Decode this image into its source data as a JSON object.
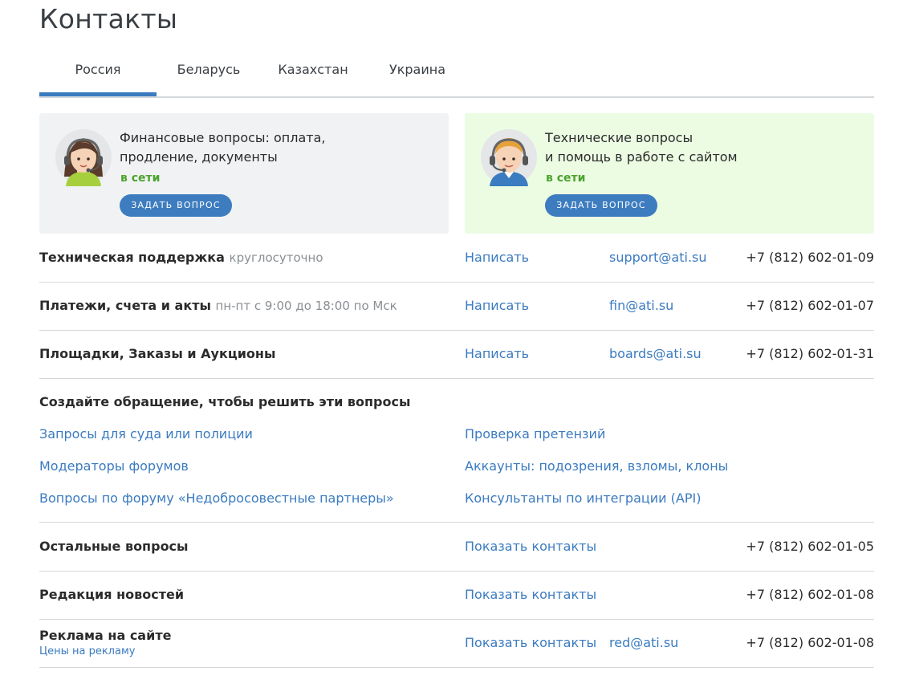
{
  "page": {
    "title": "Контакты"
  },
  "tabs": [
    {
      "label": "Россия",
      "active": true
    },
    {
      "label": "Беларусь",
      "active": false
    },
    {
      "label": "Казахстан",
      "active": false
    },
    {
      "label": "Украина",
      "active": false
    }
  ],
  "cards": {
    "finance": {
      "line1": "Финансовые вопросы: оплата,",
      "line2": "продление, документы",
      "status": "в сети",
      "button": "ЗАДАТЬ ВОПРОС",
      "avatar_icon": "female-operator-headset-icon",
      "background": "#f1f2f3"
    },
    "technical": {
      "line1": "Технические вопросы",
      "line2": "и помощь в работе с сайтом",
      "status": "в сети",
      "button": "ЗАДАТЬ ВОПРОС",
      "avatar_icon": "male-operator-headset-icon",
      "background": "#ecfce3"
    }
  },
  "rows": {
    "support": {
      "label": "Техническая поддержка",
      "note": "круглосуточно",
      "action": "Написать",
      "email": "support@ati.su",
      "phone": "+7 (812) 602-01-09"
    },
    "payments": {
      "label": "Платежи, счета и акты",
      "note": "пн-пт с 9:00 до 18:00 по Мск",
      "action": "Написать",
      "email": "fin@ati.su",
      "phone": "+7 (812) 602-01-07"
    },
    "boards": {
      "label": "Площадки, Заказы и Аукционы",
      "action": "Написать",
      "email": "boards@ati.su",
      "phone": "+7 (812) 602-01-31"
    },
    "other": {
      "label": "Остальные вопросы",
      "action": "Показать контакты",
      "phone": "+7 (812) 602-01-05"
    },
    "news": {
      "label": "Редакция новостей",
      "action": "Показать контакты",
      "phone": "+7 (812) 602-01-08"
    },
    "ads": {
      "label": "Реклама на сайте",
      "sublink": "Цены на рекламу",
      "action": "Показать контакты",
      "email": "red@ati.su",
      "phone": "+7 (812) 602-01-08"
    }
  },
  "appeals": {
    "title": "Создайте обращение, чтобы решить эти вопросы",
    "left": [
      "Запросы для суда или полиции",
      "Модераторы форумов",
      "Вопросы по форуму «Недобросовестные партнеры»"
    ],
    "right": [
      "Проверка претензий",
      "Аккаунты: подозрения, взломы, клоны",
      "Консультанты по интеграции (API)"
    ]
  },
  "colors": {
    "accent": "#3b7bc0",
    "online": "#4ca32e",
    "button": "#3d7cbf"
  }
}
